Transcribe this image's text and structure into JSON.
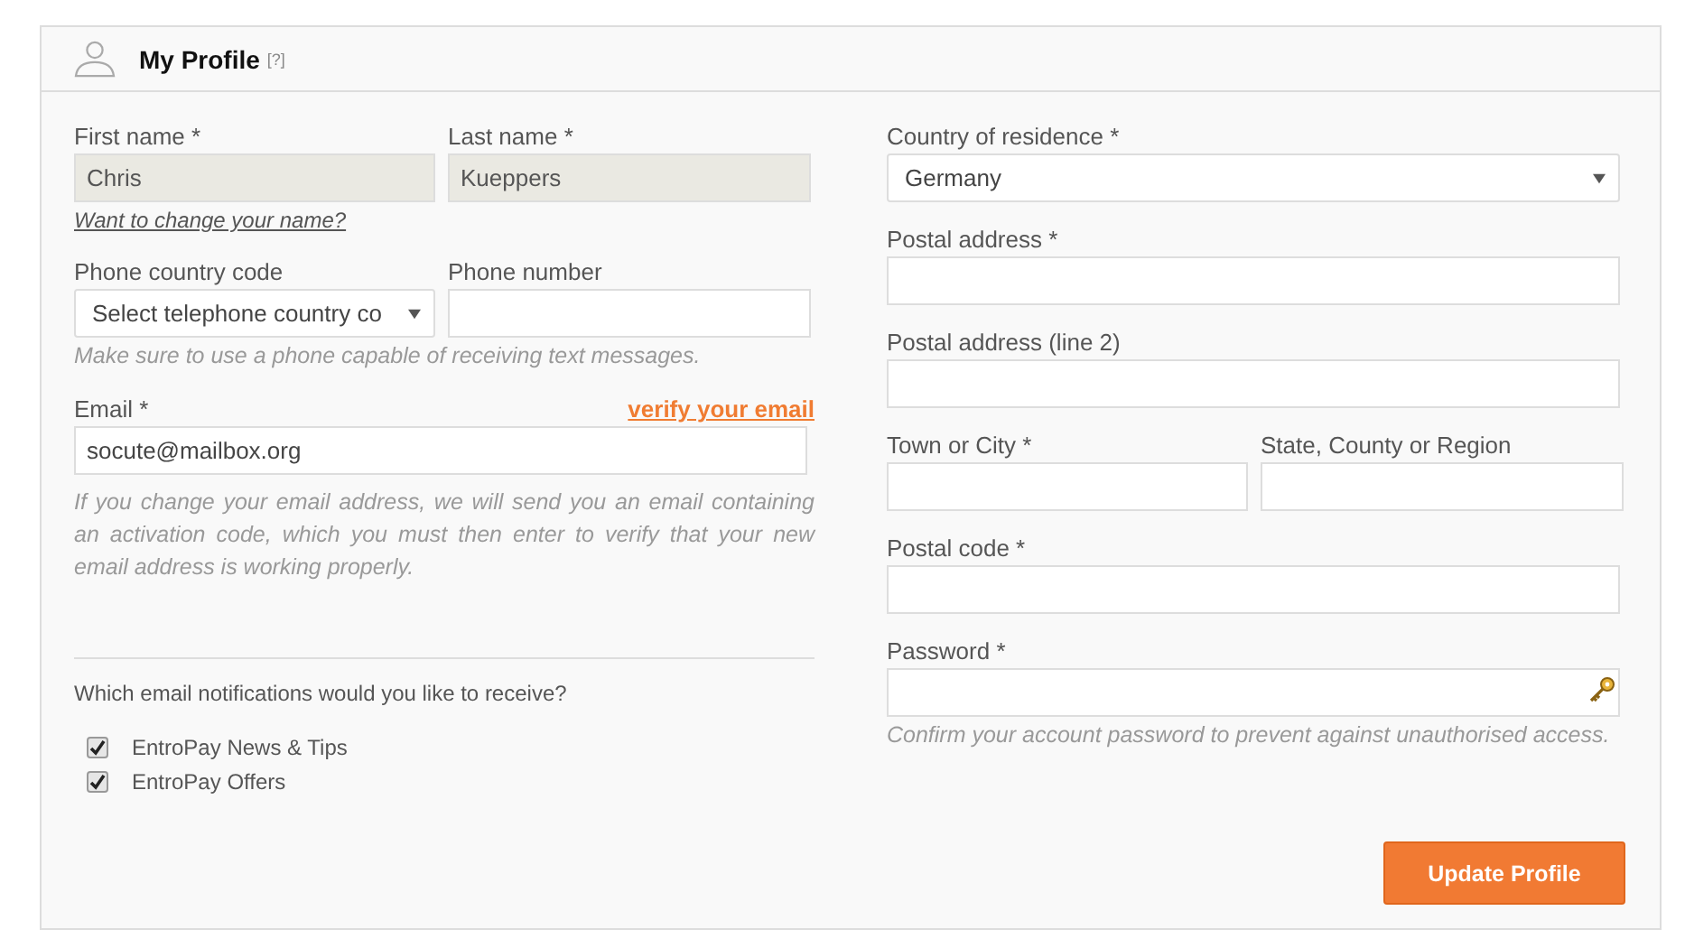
{
  "header": {
    "title": "My Profile",
    "help": "[?]"
  },
  "name_fields": [
    {
      "label": "First name *",
      "value": "Chris",
      "disabled": true
    },
    {
      "label": "Last name *",
      "value": "Kueppers",
      "disabled": true
    }
  ],
  "name_link": "Want to change your name?",
  "phone": {
    "code_label": "Phone country code",
    "code_value": "Select telephone country co",
    "number_label": "Phone number",
    "hint": "Make sure to use a phone capable of receiving text messages."
  },
  "email": {
    "label": "Email *",
    "verify_link": "verify your email",
    "value": "socute@mailbox.org",
    "hint": "If you change your email address, we will send you an email containing an activation code, which you must then enter to verify that your new email address is working properly."
  },
  "notifications": {
    "question": "Which email notifications would you like to receive?",
    "options": [
      {
        "label": "EntroPay News & Tips",
        "checked": true
      },
      {
        "label": "EntroPay Offers",
        "checked": true
      }
    ]
  },
  "address_fields": [
    {
      "kind": "select",
      "label": "Country of residence *",
      "value": "Germany"
    },
    {
      "kind": "text",
      "label": "Postal address *"
    },
    {
      "kind": "text",
      "label": "Postal address (line 2)"
    },
    {
      "kind": "pair",
      "items": [
        {
          "label": "Town or City *"
        },
        {
          "label": "State, County or Region"
        }
      ]
    },
    {
      "kind": "text",
      "label": "Postal code *"
    },
    {
      "kind": "password",
      "label": "Password *",
      "hint": "Confirm your account password to prevent against unauthorised access."
    }
  ],
  "button": "Update Profile"
}
